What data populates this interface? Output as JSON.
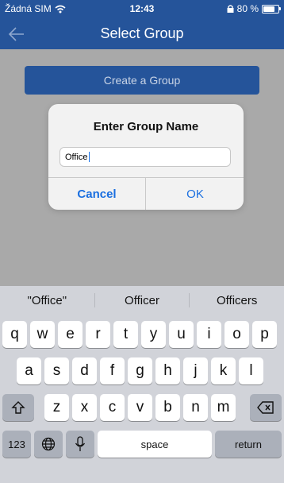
{
  "status_bar": {
    "carrier": "Žádná SIM",
    "time": "12:43",
    "battery_text": "80 %",
    "battery_level": 0.8
  },
  "header": {
    "title": "Select Group"
  },
  "main": {
    "create_group_label": "Create a Group"
  },
  "dialog": {
    "title": "Enter Group Name",
    "input_value": "Office",
    "cancel_label": "Cancel",
    "ok_label": "OK"
  },
  "keyboard": {
    "suggestions": [
      "\"Office\"",
      "Officer",
      "Officers"
    ],
    "row1": [
      "q",
      "w",
      "e",
      "r",
      "t",
      "y",
      "u",
      "i",
      "o",
      "p"
    ],
    "row2": [
      "a",
      "s",
      "d",
      "f",
      "g",
      "h",
      "j",
      "k",
      "l"
    ],
    "row3": [
      "z",
      "x",
      "c",
      "v",
      "b",
      "n",
      "m"
    ],
    "numbers_label": "123",
    "space_label": "space",
    "return_label": "return"
  },
  "colors": {
    "header": "#25549a",
    "accent": "#1a6fe0",
    "overlay": "#a9a9a9",
    "keyboard": "#d1d3d9"
  }
}
